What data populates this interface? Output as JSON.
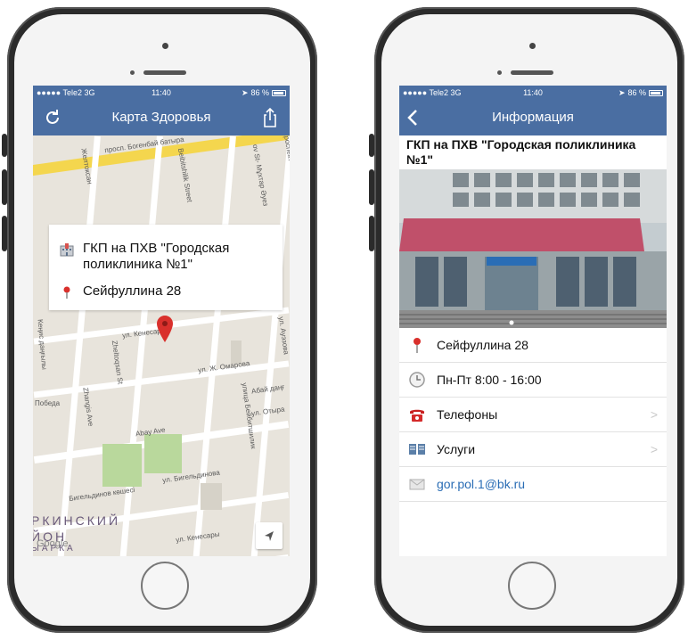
{
  "left_phone": {
    "status": {
      "carrier": "●●●●● Tele2  3G",
      "time": "11:40",
      "battery_text": "86 %"
    },
    "nav": {
      "title": "Карта Здоровья",
      "left_icon": "refresh-icon",
      "right_icon": "share-icon"
    },
    "map": {
      "street_labels": [
        "просп. Богенбай батыра",
        "Желтоксан",
        "Beibitshilik Street",
        "ov St- Мұхтар Әуез",
        "проспект",
        "ул. Кенесары",
        "ул. Ж. Омарова",
        "Абай даңғ",
        "Abay Ave",
        "ул. Отыра",
        "Бигельдинов көшесі",
        "ул. Бигельдинова",
        "Zhangis Ave",
        "Победа",
        "Кеңис даңғылы",
        "Zheltoqsan St",
        "улица Бейбитшилик",
        "ул. Ауэзова",
        "ул. Кенесары"
      ],
      "district_label": "РКИНСКИЙ",
      "district_label2": "ЙОН",
      "district_label3": "ЫАРКА",
      "attribution": "Google"
    },
    "card": {
      "name": "ГКП на ПХВ \"Городская поликлиника №1\"",
      "address": "Сейфуллина 28",
      "name_icon": "hospital-icon",
      "address_icon": "location-pin-icon"
    }
  },
  "right_phone": {
    "status": {
      "carrier": "●●●●● Tele2  3G",
      "time": "11:40",
      "battery_text": "86 %"
    },
    "nav": {
      "title": "Информация",
      "back_icon": "back-chevron-icon"
    },
    "title": "ГКП на ПХВ \"Городская поликлиника №1\"",
    "rows": [
      {
        "icon": "location-pin-icon",
        "label": "Сейфуллина 28",
        "chevron": false
      },
      {
        "icon": "clock-icon",
        "label": "Пн-Пт 8:00 - 16:00",
        "chevron": false
      },
      {
        "icon": "telephone-icon",
        "label": "Телефоны",
        "chevron": true
      },
      {
        "icon": "book-icon",
        "label": "Услуги",
        "chevron": true
      },
      {
        "icon": "mail-icon",
        "label": "gor.pol.1@bk.ru",
        "chevron": false
      }
    ],
    "chevron_glyph": ">"
  }
}
